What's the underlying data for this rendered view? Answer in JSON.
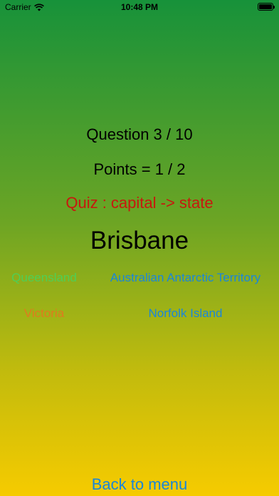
{
  "status_bar": {
    "carrier": "Carrier",
    "time": "10:48 PM",
    "battery_level": 1.0
  },
  "quiz": {
    "question": "Question 3 / 10",
    "points": "Points = 1 / 2",
    "mode": "Quiz : capital -> state",
    "prompt": "Brisbane",
    "answers": [
      {
        "label": "Queensland",
        "color": "#4fcf55"
      },
      {
        "label": "Australian Antarctic Territory",
        "color": "#1a86d9"
      },
      {
        "label": "Victoria",
        "color": "#e07a1d"
      },
      {
        "label": "Norfolk Island",
        "color": "#1a86d9"
      }
    ],
    "back_label": "Back to menu"
  },
  "colors": {
    "gradient_top": "#17923a",
    "gradient_bottom": "#f6cb00",
    "mode_text": "#c8180e",
    "link": "#1a86d9"
  }
}
